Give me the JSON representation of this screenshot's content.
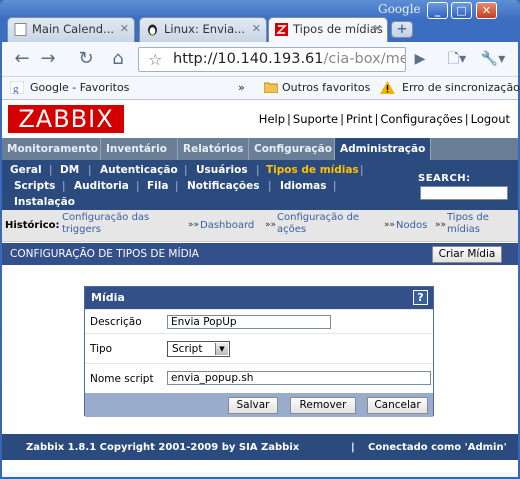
{
  "browser": {
    "brand": "Google",
    "tabs": [
      {
        "label": "Main Calend..."
      },
      {
        "label": "Linux: Envia..."
      },
      {
        "label": "Tipos de mídias"
      }
    ],
    "url_host": "http://10.140.193.61",
    "url_path": "/cia-box/media",
    "bookmarks": {
      "left": "Google - Favoritos",
      "chevron": "»",
      "others": "Outros favoritos",
      "sync": "Erro de sincronização"
    }
  },
  "zabbix": {
    "logo": "ZABBIX",
    "toplinks": [
      "Help",
      "Suporte",
      "Print",
      "Configurações",
      "Logout"
    ],
    "mainmenu": [
      "Monitoramento",
      "Inventário",
      "Relatórios",
      "Configuração",
      "Administração"
    ],
    "submenu_row1": [
      "Geral",
      "DM",
      "Autenticação",
      "Usuários",
      "Tipos de mídias"
    ],
    "submenu_row2": [
      "Scripts",
      "Auditoria",
      "Fila",
      "Notificações",
      "Idiomas"
    ],
    "submenu_row3": [
      "Instalação"
    ],
    "search_label": "SEARCH:",
    "history_label": "Histórico:",
    "history": [
      {
        "line1": "Configuração das",
        "line2": "triggers"
      },
      {
        "line1": "Dashboard",
        "line2": ""
      },
      {
        "line1": "Configuração de",
        "line2": "ações"
      },
      {
        "line1": "Nodos",
        "line2": ""
      },
      {
        "line1": "Tipos de",
        "line2": "mídias"
      }
    ],
    "section_title": "CONFIGURAÇÃO DE TIPOS DE MÍDIA",
    "create_button": "Criar Mídia",
    "form": {
      "title": "Mídia",
      "help": "?",
      "description_label": "Descrição",
      "description_value": "Envia PopUp",
      "type_label": "Tipo",
      "type_value": "Script",
      "script_label": "Nome script",
      "script_value": "envia_popup.sh",
      "save": "Salvar",
      "remove": "Remover",
      "cancel": "Cancelar"
    },
    "footer_left": "Zabbix 1.8.1 Copyright 2001-2009 by SIA Zabbix",
    "footer_sep": "|",
    "footer_right": "Conectado como 'Admin'"
  }
}
